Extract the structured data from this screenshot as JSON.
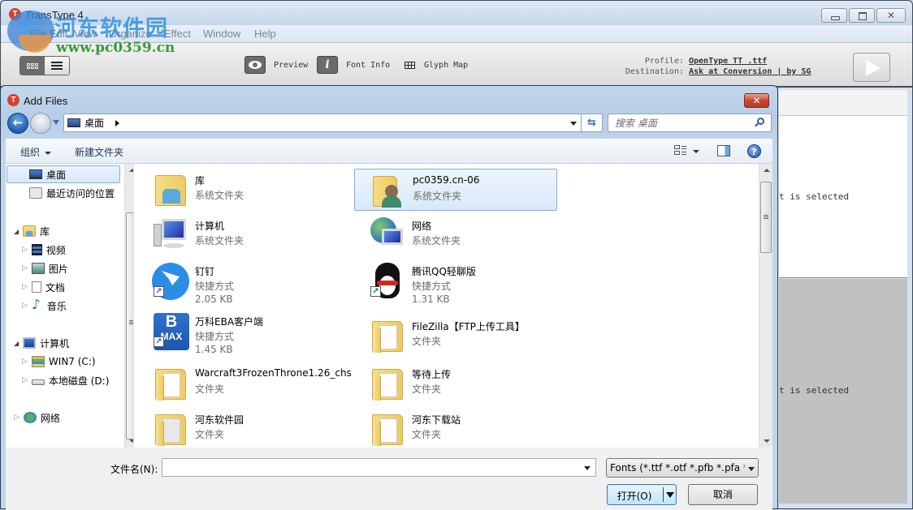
{
  "app": {
    "title": "TransType 4",
    "logo_letter": "T",
    "window_buttons": {
      "minimize": "minimize",
      "maximize": "maximize",
      "close": "✕"
    },
    "menu": [
      "File",
      "Edit",
      "View",
      "Organize",
      "Effect",
      "Window",
      "Help"
    ],
    "toolbar": {
      "preview_label": "Preview",
      "font_info_label": "Font Info",
      "font_info_glyph": "i",
      "glyph_map_label": "Glyph Map",
      "profile_key": "Profile:",
      "profile_value": "OpenType TT .ttf",
      "destination_key": "Destination:",
      "destination_value": "Ask at Conversion | by SG"
    },
    "pane_top_message": "t is selected",
    "pane_bottom_message": "t is selected"
  },
  "watermark": {
    "site_name": "河东软件园",
    "url": "www.pc0359.cn"
  },
  "dialog": {
    "title": "Add Files",
    "logo_letter": "T",
    "close_label": "✕",
    "back_glyph": "←",
    "refresh_glyph": "⇆",
    "address": {
      "location": "桌面"
    },
    "search": {
      "placeholder": "搜索 桌面"
    },
    "commands": {
      "organize": "组织",
      "new_folder": "新建文件夹"
    },
    "help_glyph": "?",
    "nav": [
      {
        "label": "桌面",
        "icon": "desktop-icon",
        "selected": true
      },
      {
        "label": "最近访问的位置",
        "icon": "recent-places-icon"
      },
      {
        "label": "库",
        "icon": "libraries-icon",
        "expanded": true
      },
      {
        "label": "视频",
        "icon": "videos-icon"
      },
      {
        "label": "图片",
        "icon": "pictures-icon"
      },
      {
        "label": "文档",
        "icon": "documents-icon"
      },
      {
        "label": "音乐",
        "icon": "music-icon"
      },
      {
        "label": "计算机",
        "icon": "computer-icon",
        "expanded": true
      },
      {
        "label": "WIN7 (C:)",
        "icon": "drive-c-icon"
      },
      {
        "label": "本地磁盘 (D:)",
        "icon": "drive-d-icon"
      },
      {
        "label": "网络",
        "icon": "network-icon"
      }
    ],
    "files": [
      {
        "name": "库",
        "type": "系统文件夹",
        "size": "",
        "icon": "libraries-icon"
      },
      {
        "name": "pc0359.cn-06",
        "type": "系统文件夹",
        "size": "",
        "icon": "user-folder-icon",
        "selected": true
      },
      {
        "name": "计算机",
        "type": "系统文件夹",
        "size": "",
        "icon": "computer-icon"
      },
      {
        "name": "网络",
        "type": "系统文件夹",
        "size": "",
        "icon": "network-icon"
      },
      {
        "name": "钉钉",
        "type": "快捷方式",
        "size": "2.05 KB",
        "icon": "dingtalk-icon"
      },
      {
        "name": "腾讯QQ轻聊版",
        "type": "快捷方式",
        "size": "1.31 KB",
        "icon": "qq-icon"
      },
      {
        "name": "万科EBA客户端",
        "type": "快捷方式",
        "size": "1.45 KB",
        "icon": "bmax-icon"
      },
      {
        "name": "FileZilla【FTP上传工具】",
        "type": "文件夹",
        "size": "",
        "icon": "folder-icon"
      },
      {
        "name": "Warcraft3FrozenThrone1.26_chs",
        "type": "文件夹",
        "size": "",
        "icon": "folder-icon"
      },
      {
        "name": "等待上传",
        "type": "文件夹",
        "size": "",
        "icon": "folder-icon"
      },
      {
        "name": "河东软件园",
        "type": "文件夹",
        "size": "",
        "icon": "folder-icon"
      },
      {
        "name": "河东下载站",
        "type": "文件夹",
        "size": "",
        "icon": "folder-icon"
      }
    ],
    "bmax_letters": {
      "top": "B",
      "bottom": "MAX"
    },
    "filename_label": "文件名(N):",
    "filename_value": "",
    "filter_selected": "Fonts (*.ttf *.otf *.pfb *.pfa *.otc",
    "open_label": "打开(O)",
    "cancel_label": "取消"
  }
}
